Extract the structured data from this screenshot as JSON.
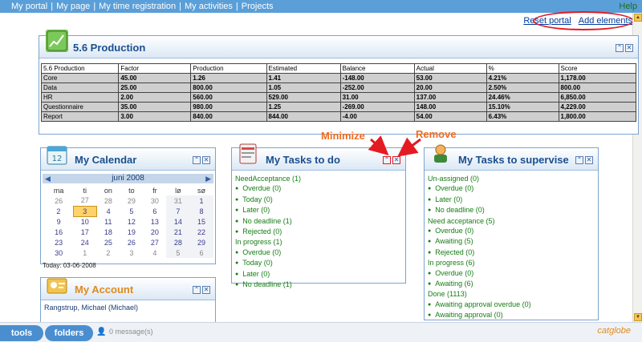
{
  "nav": {
    "items": [
      "My portal",
      "My page",
      "My time registration",
      "My activities",
      "Projects"
    ],
    "help": "Help"
  },
  "portal_links": {
    "reset": "Reset portal",
    "add": "Add elements"
  },
  "production": {
    "title": "5.6 Production",
    "columns": [
      "5.6 Production",
      "Factor",
      "Production",
      "Estimated",
      "Balance",
      "Actual",
      "%",
      "Score"
    ],
    "rows": [
      [
        "Core",
        "45.00",
        "1.26",
        "1.41",
        "-148.00",
        "53.00",
        "4.21%",
        "1,178.00"
      ],
      [
        "Data",
        "25.00",
        "800.00",
        "1.05",
        "-252.00",
        "20.00",
        "2.50%",
        "800.00"
      ],
      [
        "HR",
        "2.00",
        "560.00",
        "529.00",
        "31.00",
        "137.00",
        "24.46%",
        "6,850.00"
      ],
      [
        "Questionnaire",
        "35.00",
        "980.00",
        "1.25",
        "-269.00",
        "148.00",
        "15.10%",
        "4,229.00"
      ],
      [
        "Report",
        "3.00",
        "840.00",
        "844.00",
        "-4.00",
        "54.00",
        "6.43%",
        "1,800.00"
      ]
    ]
  },
  "calendar": {
    "title": "My Calendar",
    "month": "juni 2008",
    "days": [
      "ma",
      "ti",
      "on",
      "to",
      "fr",
      "lø",
      "sø"
    ],
    "weeks": [
      [
        "26",
        "27",
        "28",
        "29",
        "30",
        "31",
        "1"
      ],
      [
        "2",
        "3",
        "4",
        "5",
        "6",
        "7",
        "8"
      ],
      [
        "9",
        "10",
        "11",
        "12",
        "13",
        "14",
        "15"
      ],
      [
        "16",
        "17",
        "18",
        "19",
        "20",
        "21",
        "22"
      ],
      [
        "23",
        "24",
        "25",
        "26",
        "27",
        "28",
        "29"
      ],
      [
        "30",
        "1",
        "2",
        "3",
        "4",
        "5",
        "6"
      ]
    ],
    "today_label": "Today: 03-06-2008"
  },
  "tasks_todo": {
    "title": "My Tasks to do",
    "lines": [
      {
        "text": "NeedAcceptance (1)",
        "sub": false
      },
      {
        "text": "Overdue (0)",
        "sub": true
      },
      {
        "text": "Today (0)",
        "sub": true
      },
      {
        "text": "Later (0)",
        "sub": true
      },
      {
        "text": "No deadline (1)",
        "sub": true
      },
      {
        "text": "Rejected (0)",
        "sub": true
      },
      {
        "text": "In progress (1)",
        "sub": false
      },
      {
        "text": "Overdue (0)",
        "sub": true
      },
      {
        "text": "Today (0)",
        "sub": true
      },
      {
        "text": "Later (0)",
        "sub": true
      },
      {
        "text": "No deadline (1)",
        "sub": true
      }
    ]
  },
  "tasks_supervise": {
    "title": "My Tasks to supervise",
    "lines": [
      {
        "text": "Un-assigned (0)",
        "sub": false
      },
      {
        "text": "Overdue (0)",
        "sub": true
      },
      {
        "text": "Later (0)",
        "sub": true
      },
      {
        "text": "No deadline (0)",
        "sub": true
      },
      {
        "text": "Need acceptance (5)",
        "sub": false
      },
      {
        "text": "Overdue (0)",
        "sub": true
      },
      {
        "text": "Awaiting (5)",
        "sub": true
      },
      {
        "text": "Rejected (0)",
        "sub": true
      },
      {
        "text": "In progress (6)",
        "sub": false
      },
      {
        "text": "Overdue (0)",
        "sub": true
      },
      {
        "text": "Awaiting (6)",
        "sub": true
      },
      {
        "text": "Done (1113)",
        "sub": false
      },
      {
        "text": "Awaiting approval overdue (0)",
        "sub": true
      },
      {
        "text": "Awaiting approval (0)",
        "sub": true
      }
    ]
  },
  "account": {
    "title": "My Account",
    "name": "Rangstrup, Michael (Michael)"
  },
  "annotations": {
    "minimize": "Minimize",
    "remove": "Remove"
  },
  "bottom": {
    "tools": "tools",
    "folders": "folders",
    "messages": "0 message(s)",
    "brand": "catglobe"
  },
  "colors": {
    "accent": "#5a9fd8",
    "annotation": "#f26b1d",
    "oval": "#e31b23",
    "task_text": "#167d16"
  }
}
